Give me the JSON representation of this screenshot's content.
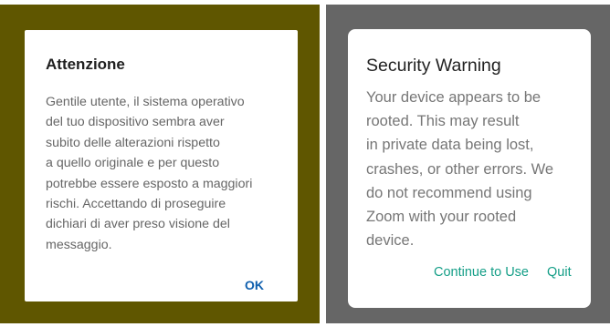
{
  "left_dialog": {
    "title": "Attenzione",
    "message": "Gentile utente, il sistema operativo\ndel tuo dispositivo sembra aver\nsubito delle alterazioni rispetto\na quello originale e per questo\npotrebbe essere esposto a maggiori\nrischi. Accettando di proseguire\ndichiari di aver preso visione del\nmessaggio.",
    "ok_label": "OK"
  },
  "right_dialog": {
    "title": "Security Warning",
    "message": "Your device appears to be\nrooted. This may result\nin private data being lost,\ncrashes, or other errors. We\ndo not recommend using\nZoom with your rooted\ndevice.",
    "continue_label": "Continue to Use",
    "quit_label": "Quit"
  },
  "colors": {
    "left_backdrop": "#5f5600",
    "right_backdrop": "#666666",
    "ok_button": "#0f5fae",
    "right_buttons": "#149e87"
  }
}
